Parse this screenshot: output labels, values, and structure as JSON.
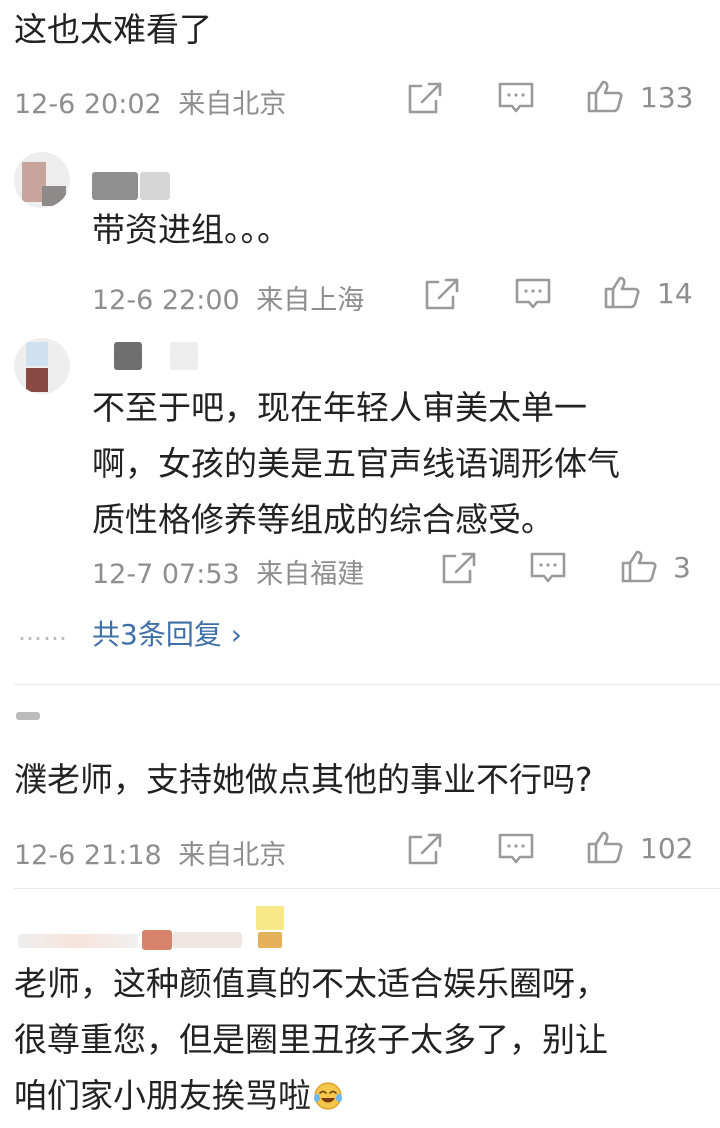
{
  "comments": [
    {
      "text": "这也太难看了",
      "date": "12-6 20:02",
      "location": "来自北京",
      "likes": "133"
    },
    {
      "text": "带资进组。。。",
      "date": "12-6 22:00",
      "location": "来自上海",
      "likes": "14"
    },
    {
      "text_lines": [
        "不至于吧，现在年轻人审美太单一",
        "啊，女孩的美是五官声线语调形体气",
        "质性格修养等组成的综合感受。"
      ],
      "date": "12-7 07:53",
      "location": "来自福建",
      "likes": "3",
      "replies_dots": "……",
      "replies_label": "共3条回复 ›"
    },
    {
      "text": "濮老师，支持她做点其他的事业不行吗?",
      "date": "12-6 21:18",
      "location": "来自北京",
      "likes": "102"
    },
    {
      "text_lines": [
        "老师，这种颜值真的不太适合娱乐圈呀，",
        "很尊重您，但是圈里丑孩子太多了，别让",
        "咱们家小朋友挨骂啦"
      ]
    }
  ],
  "icons": {
    "share": "share-icon",
    "comment": "comment-icon",
    "like": "thumbs-up-icon",
    "emoji": "crying-laughing-emoji"
  },
  "colors": {
    "link": "#3f6fa8",
    "meta": "#8e8e8e"
  }
}
